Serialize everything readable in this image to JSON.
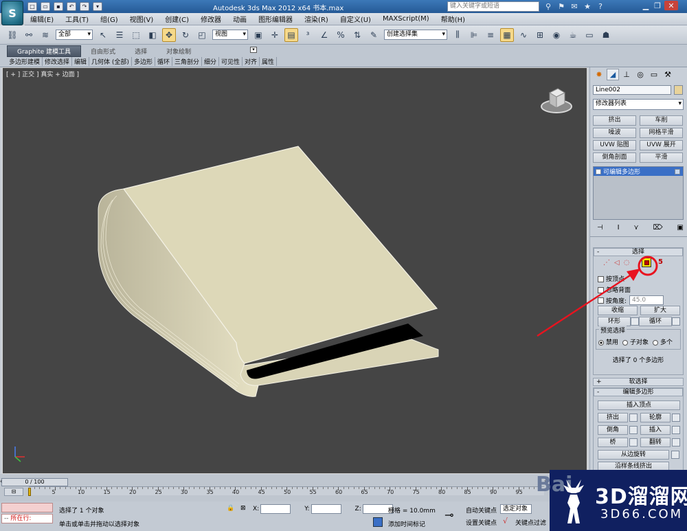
{
  "app": {
    "logo_label": "S",
    "title": "Autodesk 3ds Max  2012 x64     书本.max",
    "search_placeholder": "键入关键字或短语"
  },
  "menubar": [
    "编辑(E)",
    "工具(T)",
    "组(G)",
    "视图(V)",
    "创建(C)",
    "修改器",
    "动画",
    "图形编辑器",
    "渲染(R)",
    "自定义(U)",
    "MAXScript(M)",
    "帮助(H)"
  ],
  "toolbar": {
    "selection_filter": "全部",
    "reference_coord": "视图",
    "named_selection_set": "创建选择集"
  },
  "ribbon": {
    "tabs": [
      "Graphite 建模工具",
      "自由形式",
      "选择",
      "对象绘制"
    ],
    "items": [
      "多边形建模",
      "修改选择",
      "编辑",
      "几何体 (全部)",
      "多边形",
      "循环",
      "三角剖分",
      "细分",
      "可见性",
      "对齐",
      "属性"
    ]
  },
  "viewport": {
    "label": "[ + ] 正交 ] 真实 + 边面 ]"
  },
  "panel": {
    "object_name": "Line002",
    "modifier_list": "修改器列表",
    "modifier_buttons": [
      "挤出",
      "车削",
      "噪波",
      "网格平滑",
      "UVW 贴图",
      "UVW 展开",
      "倒角剖面",
      "平滑"
    ],
    "stack_item": "可编辑多边形",
    "select_rollout": {
      "title": "选择",
      "by_vertex": "按顶点",
      "ignore_backface": "忽略背面",
      "by_angle": "按角度:",
      "angle_value": "45.0",
      "shrink": "收缩",
      "grow": "扩大",
      "ring": "环形",
      "loop": "循环",
      "preview_label": "预览选择",
      "preview_options": [
        "禁用",
        "子对象",
        "多个"
      ],
      "status": "选择了 0 个多边形",
      "badge_number": "5"
    },
    "soft_selection": "软选择",
    "edit_polygons": {
      "title": "编辑多边形",
      "insert_vertex": "插入顶点",
      "buttons": [
        "挤出",
        "轮廓",
        "倒角",
        "插入",
        "桥",
        "翻转"
      ],
      "hinge": "从边旋转",
      "extrude_along": "沿样条线挤出"
    }
  },
  "timeline": {
    "frame": "0 / 100",
    "ticks": [
      "5",
      "10",
      "15",
      "20",
      "25",
      "30",
      "35",
      "40",
      "45",
      "50",
      "55",
      "60",
      "65",
      "70",
      "75",
      "80",
      "85",
      "90",
      "95"
    ]
  },
  "status": {
    "script_label": "所在行:",
    "selected": "选择了 1 个对象",
    "prompt": "单击或单击并拖动以选择对象",
    "x_label": "X:",
    "y_label": "Y:",
    "z_label": "Z:",
    "grid": "栅格 = 10.0mm",
    "add_time_tag": "添加时间标记",
    "auto_key": "自动关键点",
    "set_key": "设置关键点",
    "selected_object": "选定对象",
    "key_filters": "关键点过滤"
  },
  "watermark": {
    "brand": "3D溜溜网",
    "url": "3D66.COM",
    "baidu": "Bai"
  },
  "colors": {
    "viewport_bg": "#454545",
    "book": "#ddd8b8",
    "annotation": "#e8131f",
    "highlight_yellow": "#f7e400"
  }
}
